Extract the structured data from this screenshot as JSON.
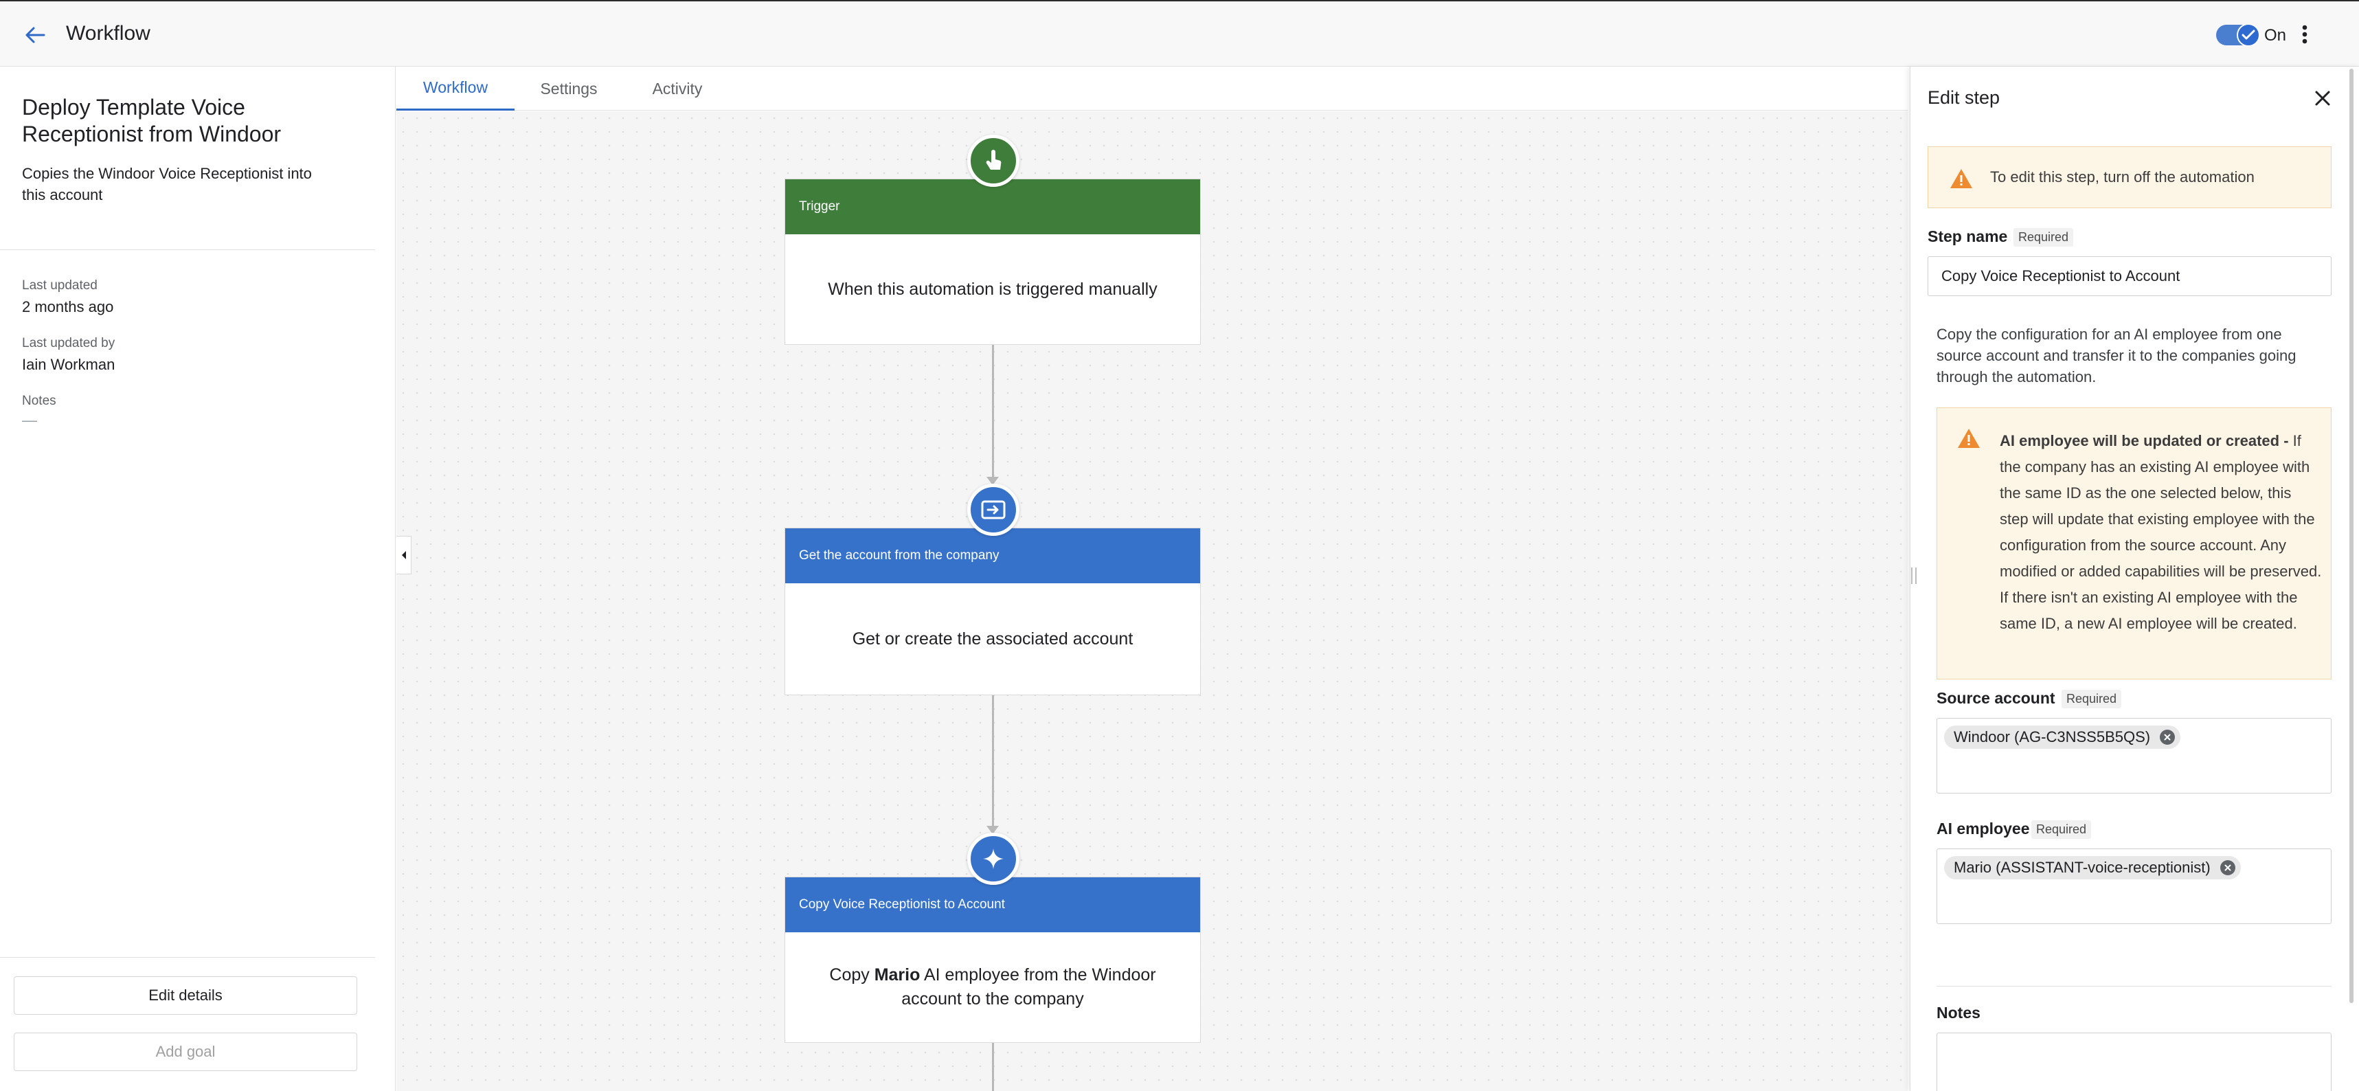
{
  "header": {
    "title": "Workflow",
    "toggle_label": "On",
    "toggle_state": "on",
    "accent_color": "#2f6bc6"
  },
  "sidebar": {
    "workflow_name": "Deploy Template Voice Receptionist from Windoor",
    "description": "Copies the Windoor Voice Receptionist into this account",
    "last_updated_label": "Last updated",
    "last_updated_value": "2 months ago",
    "last_updated_by_label": "Last updated by",
    "last_updated_by_value": "Iain Workman",
    "notes_label": "Notes",
    "notes_value": "—",
    "edit_details_label": "Edit details",
    "add_goal_label": "Add goal"
  },
  "tabs": [
    {
      "label": "Workflow",
      "active": true
    },
    {
      "label": "Settings",
      "active": false
    },
    {
      "label": "Activity",
      "active": false
    }
  ],
  "nodes": [
    {
      "header": "Trigger",
      "body": "When this automation is triggered manually",
      "color": "#3f7d3a",
      "icon": "pointer-hand-icon"
    },
    {
      "header": "Get the account from the company",
      "body": "Get or create the associated account",
      "color": "#3672c9",
      "icon": "account-transfer-icon"
    },
    {
      "header": "Copy Voice Receptionist to Account",
      "body_pre": "Copy ",
      "body_bold": "Mario",
      "body_post": " AI employee from the Windoor account to the company",
      "color": "#3672c9",
      "icon": "sparkle-icon"
    }
  ],
  "panel": {
    "title": "Edit step",
    "warning_text": "To edit this step, turn off the automation",
    "step_name_label": "Step name",
    "required_label": "Required",
    "step_name_value": "Copy Voice Receptionist to Account",
    "description": "Copy the configuration for an AI employee from one source account and transfer it to the companies going through the automation.",
    "update_warning_bold": "AI employee will be updated or created -",
    "update_warning_text": " If the company has an existing AI employee with the same ID as the one selected below, this step will update that existing employee with the configuration from the source account. Any modified or added capabilities will be preserved. If there isn't an existing AI employee with the same ID, a new AI employee will be created.",
    "source_account_label": "Source account",
    "source_account_value": "Windoor (AG-C3NSS5B5QS)",
    "ai_employee_label": "AI employee",
    "ai_employee_value": "Mario (ASSISTANT-voice-receptionist)",
    "notes_label": "Notes"
  }
}
